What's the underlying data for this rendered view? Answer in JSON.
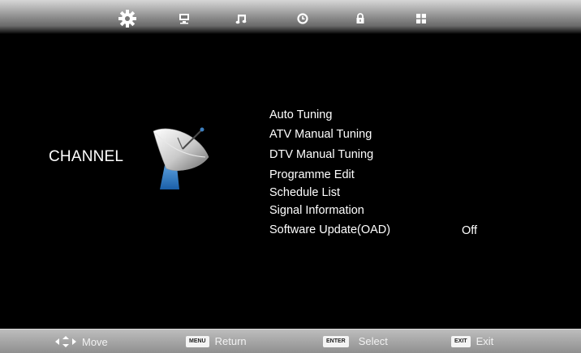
{
  "header": {
    "tabs": [
      {
        "icon": "gear-icon",
        "active": true
      },
      {
        "icon": "monitor-icon",
        "active": false
      },
      {
        "icon": "music-note-icon",
        "active": false
      },
      {
        "icon": "clock-icon",
        "active": false
      },
      {
        "icon": "lock-icon",
        "active": false
      },
      {
        "icon": "grid-icon",
        "active": false
      }
    ]
  },
  "section": {
    "title": "CHANNEL",
    "icon": "satellite-dish-icon"
  },
  "menu": {
    "items": [
      {
        "label": "Auto Tuning"
      },
      {
        "label": "ATV Manual Tuning"
      },
      {
        "label": "DTV Manual Tuning"
      },
      {
        "label": "Programme Edit"
      },
      {
        "label": "Schedule List"
      },
      {
        "label": "Signal Information"
      },
      {
        "label": "Software Update(OAD)",
        "value": "Off"
      }
    ]
  },
  "footer": {
    "hints": [
      {
        "key": "",
        "icon": "arrows-icon",
        "label": "Move"
      },
      {
        "key": "MENU",
        "label": "Return"
      },
      {
        "key": "ENTER",
        "label": "Select"
      },
      {
        "key": "EXIT",
        "label": "Exit"
      }
    ]
  },
  "colors": {
    "background": "#000000",
    "text": "#ffffff",
    "bar_light": "#bdbdbd",
    "bar_dark": "#8e8e8e",
    "dish_blue": "#2f7fc4"
  }
}
